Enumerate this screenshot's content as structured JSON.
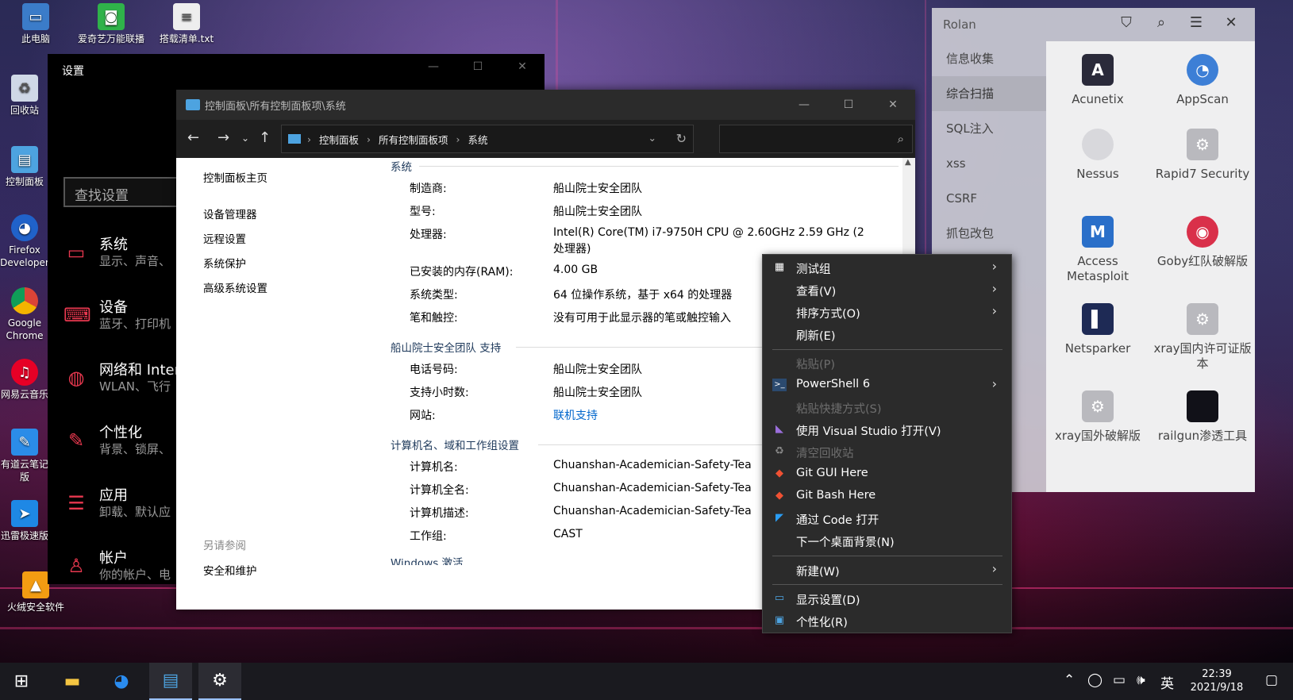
{
  "desktop": {
    "icons": [
      {
        "label": "此电脑"
      },
      {
        "label": "爱奇艺万能联播"
      },
      {
        "label": "搭载清单.txt"
      },
      {
        "label": "回收站"
      },
      {
        "label": "控制面板"
      },
      {
        "label": "Firefox Developer"
      },
      {
        "label": "Google Chrome"
      },
      {
        "label": "网易云音乐"
      },
      {
        "label": "有道云笔记版"
      },
      {
        "label": "迅雷极速版"
      },
      {
        "label": "火绒安全软件"
      }
    ]
  },
  "settings": {
    "title": "设置",
    "search_placeholder": "查找设置",
    "items": [
      {
        "title": "系统",
        "subtitle": "显示、声音、"
      },
      {
        "title": "设备",
        "subtitle": "蓝牙、打印机"
      },
      {
        "title": "网络和 Inter",
        "subtitle": "WLAN、飞行"
      },
      {
        "title": "个性化",
        "subtitle": "背景、锁屏、"
      },
      {
        "title": "应用",
        "subtitle": "卸载、默认应"
      },
      {
        "title": "帐户",
        "subtitle": "你的帐户、电"
      }
    ]
  },
  "control_panel": {
    "title": "控制面板\\所有控制面板项\\系统",
    "breadcrumb": [
      "控制面板",
      "所有控制面板项",
      "系统"
    ],
    "left_links": [
      "控制面板主页",
      "设备管理器",
      "远程设置",
      "系统保护",
      "高级系统设置"
    ],
    "see_also_label": "另请参阅",
    "see_also_links": [
      "安全和维护"
    ],
    "system_section": {
      "header": "系统",
      "rows": [
        {
          "k": "制造商:",
          "v": "船山院士安全团队"
        },
        {
          "k": "型号:",
          "v": "船山院士安全团队"
        },
        {
          "k": "处理器:",
          "v": "Intel(R) Core(TM) i7-9750H CPU @ 2.60GHz   2.59 GHz  (2",
          "v2": "处理器)"
        },
        {
          "k": "已安装的内存(RAM):",
          "v": "4.00 GB"
        },
        {
          "k": "系统类型:",
          "v": "64 位操作系统，基于 x64 的处理器"
        },
        {
          "k": "笔和触控:",
          "v": "没有可用于此显示器的笔或触控输入"
        }
      ]
    },
    "support_section": {
      "header": "船山院士安全团队 支持",
      "rows": [
        {
          "k": "电话号码:",
          "v": "船山院士安全团队"
        },
        {
          "k": "支持小时数:",
          "v": "船山院士安全团队"
        },
        {
          "k": "网站:",
          "v": "联机支持"
        }
      ]
    },
    "computer_section": {
      "header": "计算机名、域和工作组设置",
      "rows": [
        {
          "k": "计算机名:",
          "v": "Chuanshan-Academician-Safety-Tea"
        },
        {
          "k": "计算机全名:",
          "v": "Chuanshan-Academician-Safety-Tea"
        },
        {
          "k": "计算机描述:",
          "v": "Chuanshan-Academician-Safety-Tea"
        },
        {
          "k": "工作组:",
          "v": "CAST"
        }
      ]
    },
    "next_section_header": "Windows 激活"
  },
  "rolan": {
    "title": "Rolan",
    "categories": [
      "信息收集",
      "综合扫描",
      "SQL注入",
      "xss",
      "CSRF",
      "抓包改包"
    ],
    "active_category": "综合扫描",
    "apps": [
      {
        "label": "Acunetix",
        "color": "#2a2a3a",
        "glyph": "A"
      },
      {
        "label": "AppScan",
        "color": "#3d7fd6",
        "glyph": "◔"
      },
      {
        "label": "Nessus",
        "color": "#d8d8dc",
        "glyph": ""
      },
      {
        "label": "Rapid7 Security",
        "color": "#b9b9be",
        "glyph": "⚙"
      },
      {
        "label": "Access Metasploit",
        "color": "#2a6fc9",
        "glyph": "M"
      },
      {
        "label": "Goby红队破解版",
        "color": "#d9304a",
        "glyph": "◉"
      },
      {
        "label": "Netsparker",
        "color": "#1e2a55",
        "glyph": "▌"
      },
      {
        "label": "xray国内许可证版本",
        "color": "#b9b9be",
        "glyph": "⚙"
      },
      {
        "label": "xray国外破解版",
        "color": "#b9b9be",
        "glyph": "⚙"
      },
      {
        "label": "railgun渗透工具",
        "color": "#111118",
        "glyph": ""
      }
    ]
  },
  "context_menu": {
    "items": [
      {
        "label": "测试组",
        "icon": "grid-icon",
        "arrow": true
      },
      {
        "label": "查看(V)",
        "arrow": true
      },
      {
        "label": "排序方式(O)",
        "arrow": true
      },
      {
        "label": "刷新(E)"
      },
      {
        "label": "粘贴(P)",
        "disabled": true
      },
      {
        "label": "PowerShell 6",
        "icon": "powershell-icon",
        "arrow": true
      },
      {
        "label": "粘贴快捷方式(S)",
        "disabled": true
      },
      {
        "label": "使用 Visual Studio 打开(V)",
        "icon": "visual-studio-icon"
      },
      {
        "label": "清空回收站",
        "icon": "recycle-bin-icon",
        "disabled": true
      },
      {
        "label": "Git GUI Here",
        "icon": "git-icon"
      },
      {
        "label": "Git Bash Here",
        "icon": "git-icon"
      },
      {
        "label": "通过 Code 打开",
        "icon": "vscode-icon"
      },
      {
        "label": "下一个桌面背景(N)"
      },
      {
        "label": "新建(W)",
        "arrow": true
      },
      {
        "label": "显示设置(D)",
        "icon": "display-icon"
      },
      {
        "label": "个性化(R)",
        "icon": "personalize-icon"
      }
    ]
  },
  "taskbar": {
    "ime": "英",
    "time": "22:39",
    "date": "2021/9/18"
  },
  "colors": {
    "accent_red": "#e8384f",
    "link_blue": "#0066cc",
    "menu_bg": "#2b2b2b"
  }
}
